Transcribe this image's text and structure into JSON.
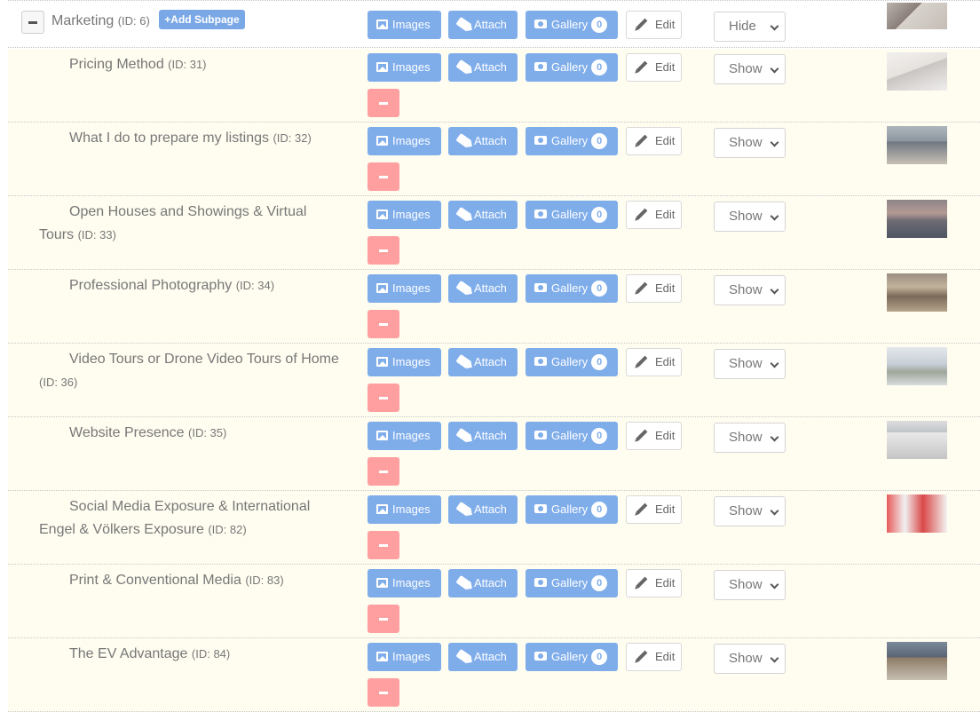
{
  "labels": {
    "images": "Images",
    "attach": "Attach",
    "gallery": "Gallery",
    "edit": "Edit",
    "add_subpage": "+Add Subpage"
  },
  "colors": {
    "button_blue": "#7fadea",
    "remove_red": "#ff9f9f",
    "child_row_bg": "#fffdf0"
  },
  "parent": {
    "title": "Marketing",
    "id_label": "(ID: 6)",
    "gallery_count": "0",
    "visibility": "Hide",
    "thumb_desc": "agent photo"
  },
  "children": [
    {
      "title": "Pricing Method",
      "id_label": "(ID: 31)",
      "gallery_count": "0",
      "visibility": "Show"
    },
    {
      "title": "What I do to prepare my listings",
      "id_label": "(ID: 32)",
      "gallery_count": "0",
      "visibility": "Show"
    },
    {
      "title": "Open Houses and Showings & Virtual Tours",
      "id_label": "(ID: 33)",
      "gallery_count": "0",
      "visibility": "Show"
    },
    {
      "title": "Professional Photography",
      "id_label": "(ID: 34)",
      "gallery_count": "0",
      "visibility": "Show"
    },
    {
      "title": "Video Tours or Drone Video Tours of Home",
      "id_label": "(ID: 36)",
      "gallery_count": "0",
      "visibility": "Show"
    },
    {
      "title": "Website Presence",
      "id_label": "(ID: 35)",
      "gallery_count": "0",
      "visibility": "Show"
    },
    {
      "title": "Social Media Exposure & International Engel & Völkers Exposure",
      "id_label": "(ID: 82)",
      "gallery_count": "0",
      "visibility": "Show"
    },
    {
      "title": "Print & Conventional Media",
      "id_label": "(ID: 83)",
      "gallery_count": "0",
      "visibility": "Show"
    },
    {
      "title": "The EV Advantage",
      "id_label": "(ID: 84)",
      "gallery_count": "0",
      "visibility": "Show"
    }
  ]
}
